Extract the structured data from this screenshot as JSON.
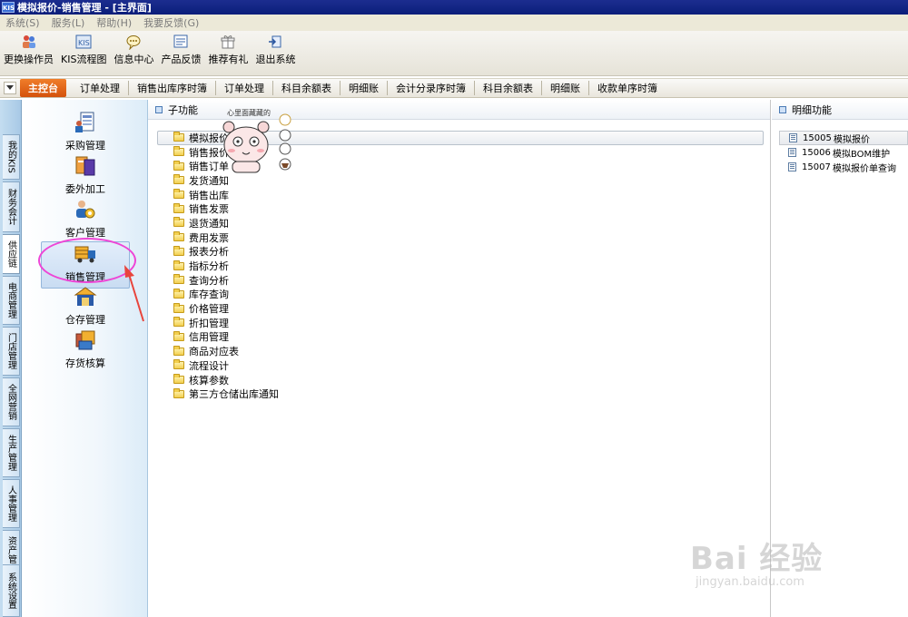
{
  "window": {
    "title": "模拟报价-销售管理 - [主界面]",
    "icon_text": "KIS"
  },
  "menubar": {
    "items": [
      "系统(S)",
      "服务(L)",
      "帮助(H)",
      "我要反馈(G)"
    ]
  },
  "toolbar": {
    "items": [
      {
        "label": "更换操作员",
        "icon": "operator-icon"
      },
      {
        "label": "KIS流程图",
        "icon": "flowchart-icon"
      },
      {
        "label": "信息中心",
        "icon": "message-icon"
      },
      {
        "label": "产品反馈",
        "icon": "feedback-icon"
      },
      {
        "label": "推荐有礼",
        "icon": "gift-icon"
      },
      {
        "label": "退出系统",
        "icon": "exit-icon"
      }
    ]
  },
  "navstrip": {
    "main_tab": "主控台",
    "links": [
      "订单处理",
      "销售出库序时簿",
      "订单处理",
      "科目余额表",
      "明细账",
      "会计分录序时簿",
      "科目余额表",
      "明细账",
      "收款单序时簿"
    ]
  },
  "vtabs": [
    "我的KIS",
    "财务会计",
    "供应链",
    "电商管理",
    "门店管理",
    "全网营销",
    "生产管理",
    "人事管理",
    "资产管理",
    "系统设置"
  ],
  "modules": [
    {
      "label": "采购管理",
      "icon": "purchase-icon"
    },
    {
      "label": "委外加工",
      "icon": "outsourcing-icon"
    },
    {
      "label": "客户管理",
      "icon": "customer-icon"
    },
    {
      "label": "销售管理",
      "icon": "sales-truck-icon"
    },
    {
      "label": "仓存管理",
      "icon": "warehouse-icon"
    },
    {
      "label": "存货核算",
      "icon": "inventory-icon"
    }
  ],
  "subpanel": {
    "header": "子功能",
    "items": [
      "模拟报价",
      "销售报价",
      "销售订单",
      "发货通知",
      "销售出库",
      "销售发票",
      "退货通知",
      "费用发票",
      "报表分析",
      "指标分析",
      "查询分析",
      "库存查询",
      "价格管理",
      "折扣管理",
      "信用管理",
      "商品对应表",
      "流程设计",
      "核算参数",
      "第三方仓储出库通知"
    ]
  },
  "detpanel": {
    "header": "明细功能",
    "items": [
      {
        "code": "15005",
        "label": "模拟报价"
      },
      {
        "code": "15006",
        "label": "模拟BOM维护"
      },
      {
        "code": "15007",
        "label": "模拟报价单查询"
      }
    ]
  },
  "sticker": {
    "text": "心里面藏藏的"
  },
  "watermark": {
    "main": "Bai 经验",
    "sub": "jingyan.baidu.com"
  },
  "colors": {
    "titlebar": "#0a1e7a",
    "main_tab": "#e06414",
    "annotation": "#ee45d6",
    "arrow": "#e8453c"
  }
}
